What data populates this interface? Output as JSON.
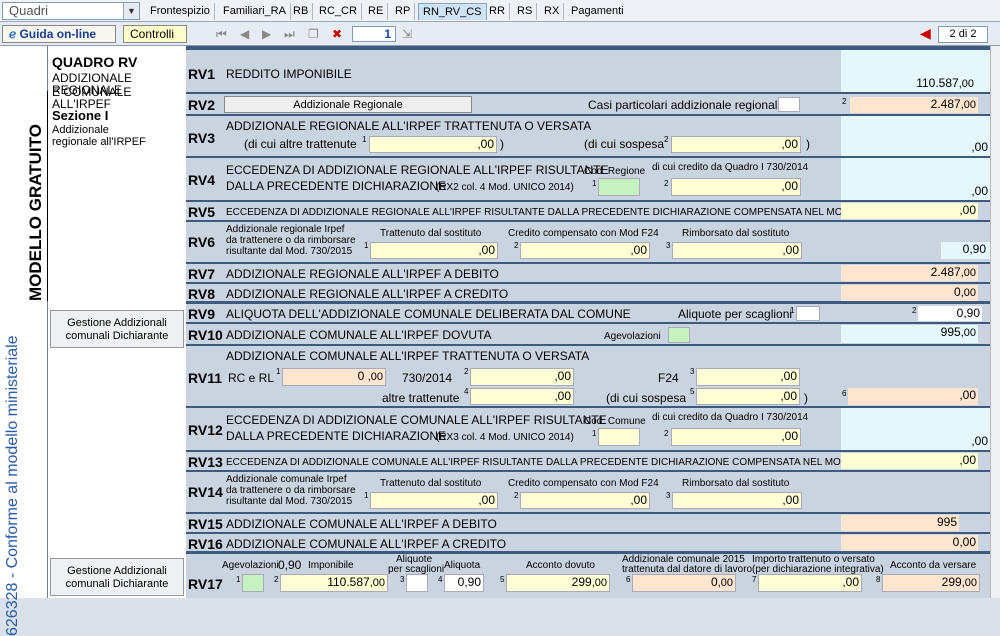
{
  "tabs": {
    "quadri": "Quadri",
    "items": [
      "Frontespizio",
      "Familiari_RA",
      "RB",
      "RC_CR",
      "RE",
      "RP",
      "RN_RV_CS",
      "RR",
      "RS",
      "RX",
      "Pagamenti"
    ]
  },
  "toolbar": {
    "guida": "Guida on-line",
    "controlli": "Controlli",
    "page": "1",
    "pagesel": "2 di 2"
  },
  "side": {
    "v1": "626328 - Conforme al modello ministeriale",
    "v2": "MODELLO GRATUITO",
    "title": "QUADRO RV",
    "sub1": "ADDIZIONALE REGIONALE",
    "sub2": "E COMUNALE ALL'IRPEF",
    "sez": "Sezione I",
    "sezsub1": "Addizionale",
    "sezsub2": "regionale all'IRPEF",
    "gest1a": "Gestione Addizionali",
    "gest1b": "comunali Dichiarante",
    "gest2a": "Gestione Addizionali",
    "gest2b": "comunali Dichiarante"
  },
  "rv1": {
    "code": "RV1",
    "label": "REDDITO IMPONIBILE",
    "value": "110.587",
    "dec": ",00"
  },
  "rv2": {
    "code": "RV2",
    "btn": "Addizionale Regionale",
    "label": "Casi particolari addizionale regionale",
    "value": "2.487",
    "dec": ",00"
  },
  "rv3": {
    "code": "RV3",
    "label": "ADDIZIONALE REGIONALE ALL'IRPEF TRATTENUTA O VERSATA",
    "l1": "(di cui altre trattenute",
    "l2": "(di cui sospesa",
    "v1": ",00",
    "v2": ",00",
    "v3": ",00"
  },
  "rv4": {
    "code": "RV4",
    "label1": "ECCEDENZA DI ADDIZIONALE REGIONALE ALL'IRPEF RISULTANTE",
    "label2": "DALLA PRECEDENTE DICHIARAZIONE",
    "note": "(RX2 col. 4   Mod. UNICO 2014)",
    "cod": "Cod. Regione",
    "cred": "di cui credito da Quadro I  730/2014",
    "v2": ",00",
    "v3": ",00"
  },
  "rv5": {
    "code": "RV5",
    "label": "ECCEDENZA DI ADDIZIONALE REGIONALE  ALL'IRPEF RISULTANTE DALLA PRECEDENTE DICHIARAZIONE COMPENSATA NEL MOD. F24",
    "value": ",00"
  },
  "rv6": {
    "code": "RV6",
    "l1": "Addizionale regionale Irpef",
    "l2": "da trattenere o da rimborsare",
    "l3": "risultante dal Mod. 730/2015",
    "h1": "Trattenuto dal sostituto",
    "h2": "Credito compensato con Mod F24",
    "h3": "Rimborsato dal sostituto",
    "v1": ",00",
    "v2": ",00",
    "v3": ",00",
    "v4": "0,90"
  },
  "rv7": {
    "code": "RV7",
    "label": "ADDIZIONALE REGIONALE ALL'IRPEF A DEBITO",
    "value": "2.487",
    "dec": ",00"
  },
  "rv8": {
    "code": "RV8",
    "label": "ADDIZIONALE REGIONALE ALL'IRPEF A CREDITO",
    "value": "0",
    "dec": ",00"
  },
  "rv9": {
    "code": "RV9",
    "label": "ALIQUOTA DELL'ADDIZIONALE COMUNALE DELIBERATA DAL COMUNE",
    "aliq": "Aliquote per scaglioni",
    "value": "0,90"
  },
  "rv10": {
    "code": "RV10",
    "label": "ADDIZIONALE COMUNALE ALL'IRPEF DOVUTA",
    "agev": "Agevolazioni",
    "value": "995",
    "dec": ",00"
  },
  "rv11": {
    "code": "RV11",
    "label": "ADDIZIONALE COMUNALE ALL'IRPEF TRATTENUTA O VERSATA",
    "rc": "RC e RL",
    "v1": "0",
    "dec": ",00",
    "l730": "730/2014",
    "f24": "F24",
    "altre": "altre trattenute",
    "sosp": "(di cui sospesa",
    "v6": ",00"
  },
  "rv12": {
    "code": "RV12",
    "label1": "ECCEDENZA DI ADDIZIONALE COMUNALE ALL'IRPEF RISULTANTE",
    "label2": "DALLA PRECEDENTE DICHIARAZIONE",
    "note": "(RX3 col. 4   Mod. UNICO 2014)",
    "cod": "Cod. Comune",
    "cred": "di cui credito da Quadro I  730/2014",
    "v2": ",00",
    "v3": ",00"
  },
  "rv13": {
    "code": "RV13",
    "label": "ECCEDENZA DI ADDIZIONALE COMUNALE ALL'IRPEF RISULTANTE DALLA PRECEDENTE DICHIARAZIONE COMPENSATA NEL MOD. F24",
    "value": ",00"
  },
  "rv14": {
    "code": "RV14",
    "l1": "Addizionale comunale Irpef",
    "l2": "da trattenere o da rimborsare",
    "l3": "risultante dal Mod. 730/2015",
    "h1": "Trattenuto dal sostituto",
    "h2": "Credito compensato con Mod F24",
    "h3": "Rimborsato dal sostituto",
    "v1": ",00",
    "v2": ",00",
    "v3": ",00"
  },
  "rv15": {
    "code": "RV15",
    "label": "ADDIZIONALE COMUNALE ALL'IRPEF A DEBITO",
    "value": "995"
  },
  "rv16": {
    "code": "RV16",
    "label": "ADDIZIONALE COMUNALE ALL'IRPEF A CREDITO",
    "value": "0,00"
  },
  "rv17": {
    "code": "RV17",
    "agev": "Agevolazioni",
    "agevval": "0,90",
    "imp": "Imponibile",
    "impval": "110.587",
    "aliqsc": "Aliquote",
    "aliqsc2": "per scaglioni",
    "aliq": "Aliquota",
    "aliqval": "0,90",
    "acconto": "Acconto dovuto",
    "accval": "299",
    "addtr1": "Addizionale comunale 2015",
    "addtr2": "trattenuta dal datore di lavoro",
    "addval": "0",
    "imptr1": "Importo trattenuto o versato",
    "imptr2": "(per dichiarazione integrativa)",
    "impval2": ",00",
    "accv": "Acconto da versare",
    "accvval": "299",
    "dec": ",00"
  }
}
